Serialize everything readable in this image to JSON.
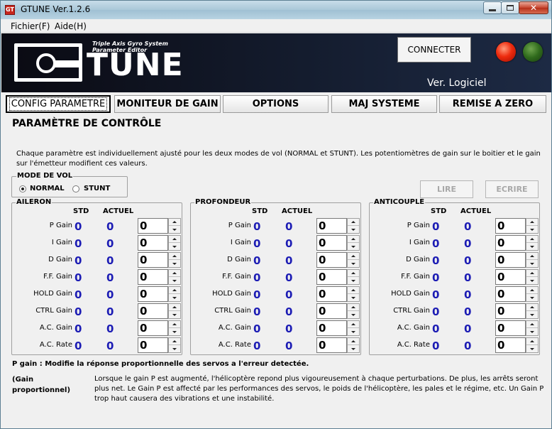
{
  "window": {
    "title": "GTUNE Ver.1.2.6",
    "app_icon": "GT"
  },
  "menu": {
    "items": [
      "Fichier(F)",
      "Aide(H)"
    ]
  },
  "header": {
    "logo_text": "TUNE",
    "logo_subtitle_1": "Triple Axis Gyro System",
    "logo_subtitle_2": "Parameter Editor",
    "connect_label": "CONNECTER",
    "version_label": "Ver. Logiciel",
    "status_colors": {
      "red": "#ee2b0e",
      "green": "#2f6a1c"
    }
  },
  "tabs": [
    {
      "label": "CONFIG PARAMETRE",
      "active": true
    },
    {
      "label": "MONITEUR DE GAIN"
    },
    {
      "label": "OPTIONS"
    },
    {
      "label": "MAJ SYSTEME"
    },
    {
      "label": "REMISE A ZERO"
    }
  ],
  "panel": {
    "title": "PARAMÈTRE DE CONTRÔLE",
    "description": "Chaque paramètre est individuellement ajusté pour les deux modes de vol (NORMAL et STUNT). Les potentiomètres de gain sur le boitier et le gain sur l'émetteur modifient ces valeurs."
  },
  "mode_vol": {
    "legend": "MODE DE VOL",
    "normal": "NORMAL",
    "stunt": "STUNT",
    "selected": "NORMAL"
  },
  "buttons": {
    "lire": "LIRE",
    "ecrire": "ECRIRE"
  },
  "columns": {
    "std": "STD",
    "actuel": "ACTUEL"
  },
  "groups": [
    {
      "name": "AILERON",
      "rows": [
        {
          "label": "P Gain",
          "std": "0",
          "actuel": "0",
          "value": "0"
        },
        {
          "label": "I Gain",
          "std": "0",
          "actuel": "0",
          "value": "0"
        },
        {
          "label": "D Gain",
          "std": "0",
          "actuel": "0",
          "value": "0"
        },
        {
          "label": "F.F. Gain",
          "std": "0",
          "actuel": "0",
          "value": "0"
        },
        {
          "label": "HOLD Gain",
          "std": "0",
          "actuel": "0",
          "value": "0"
        },
        {
          "label": "CTRL Gain",
          "std": "0",
          "actuel": "0",
          "value": "0"
        },
        {
          "label": "A.C. Gain",
          "std": "0",
          "actuel": "0",
          "value": "0"
        },
        {
          "label": "A.C. Rate",
          "std": "0",
          "actuel": "0",
          "value": "0"
        }
      ]
    },
    {
      "name": "PROFONDEUR",
      "rows": [
        {
          "label": "P Gain",
          "std": "0",
          "actuel": "0",
          "value": "0"
        },
        {
          "label": "I Gain",
          "std": "0",
          "actuel": "0",
          "value": "0"
        },
        {
          "label": "D Gain",
          "std": "0",
          "actuel": "0",
          "value": "0"
        },
        {
          "label": "F.F. Gain",
          "std": "0",
          "actuel": "0",
          "value": "0"
        },
        {
          "label": "HOLD Gain",
          "std": "0",
          "actuel": "0",
          "value": "0"
        },
        {
          "label": "CTRL Gain",
          "std": "0",
          "actuel": "0",
          "value": "0"
        },
        {
          "label": "A.C. Gain",
          "std": "0",
          "actuel": "0",
          "value": "0"
        },
        {
          "label": "A.C. Rate",
          "std": "0",
          "actuel": "0",
          "value": "0"
        }
      ]
    },
    {
      "name": "ANTICOUPLE",
      "rows": [
        {
          "label": "P Gain",
          "std": "0",
          "actuel": "0",
          "value": "0"
        },
        {
          "label": "I Gain",
          "std": "0",
          "actuel": "0",
          "value": "0"
        },
        {
          "label": "D Gain",
          "std": "0",
          "actuel": "0",
          "value": "0"
        },
        {
          "label": "F.F. Gain",
          "std": "0",
          "actuel": "0",
          "value": "0"
        },
        {
          "label": "HOLD Gain",
          "std": "0",
          "actuel": "0",
          "value": "0"
        },
        {
          "label": "CTRL Gain",
          "std": "0",
          "actuel": "0",
          "value": "0"
        },
        {
          "label": "A.C. Gain",
          "std": "0",
          "actuel": "0",
          "value": "0"
        },
        {
          "label": "A.C. Rate",
          "std": "0",
          "actuel": "0",
          "value": "0"
        }
      ]
    }
  ],
  "help": {
    "title": "P gain : Modifie la réponse proportionnelle des servos a l'erreur detectée.",
    "label": "(Gain proportionnel)",
    "text": "Lorsque le gain P est augmenté, l'hélicoptère repond plus vigoureusement à chaque perturbations. De plus, les arrêts seront plus net. Le Gain P est affecté par les performances des servos, le poids de l'hélicoptère, les pales et le régime, etc. Un Gain P trop haut causera des vibrations et une instabilité."
  }
}
